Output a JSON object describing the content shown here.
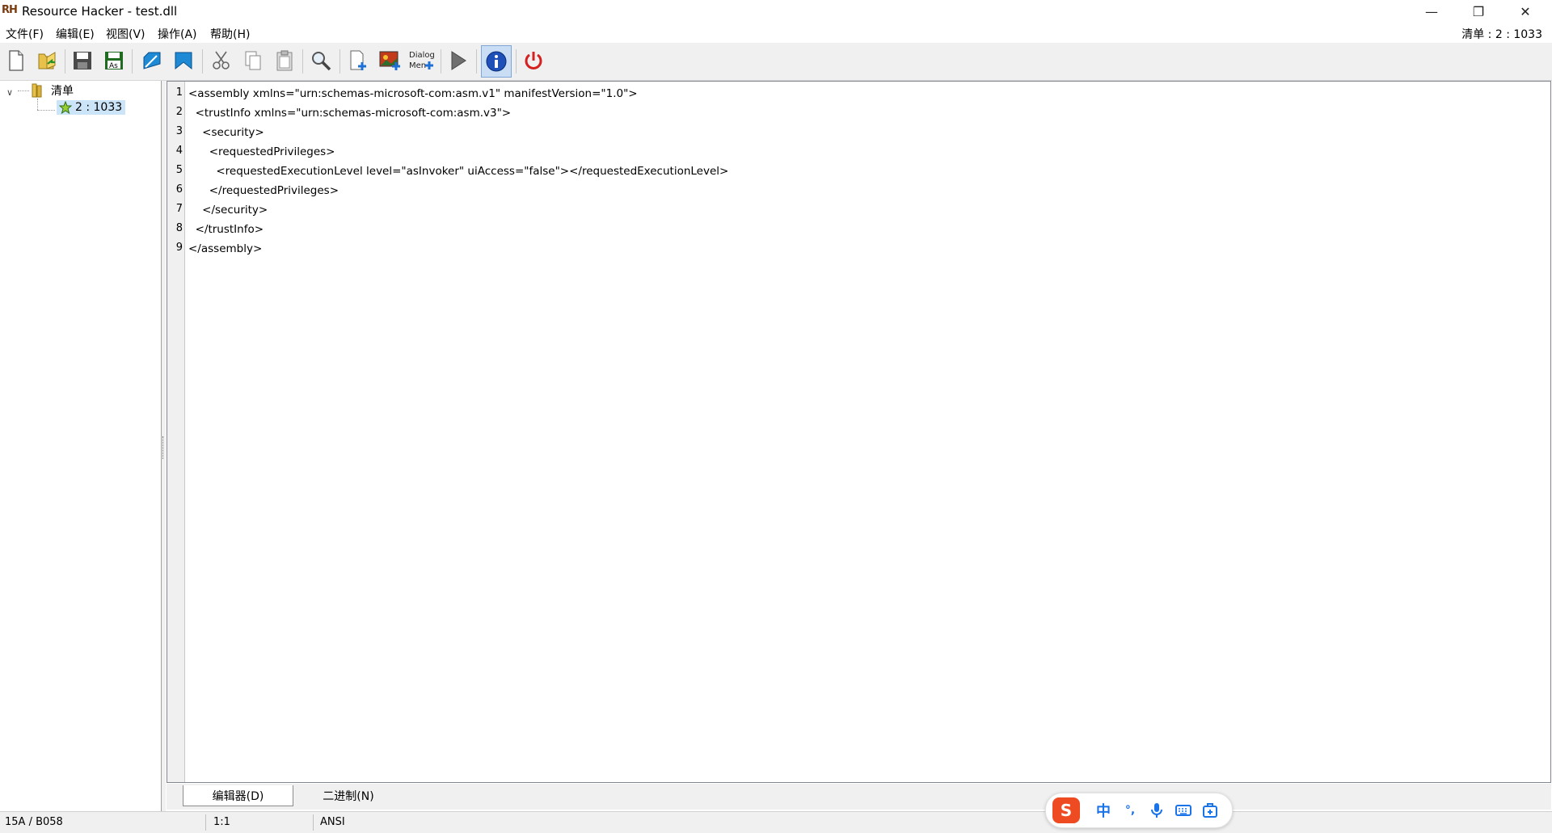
{
  "window": {
    "title": "Resource Hacker - test.dll",
    "icon_text": "RH"
  },
  "window_controls": {
    "minimize": "—",
    "restore": "❐",
    "close": "✕"
  },
  "menu": {
    "items": [
      {
        "label": "文件(F)"
      },
      {
        "label": "编辑(E)"
      },
      {
        "label": "视图(V)"
      },
      {
        "label": "操作(A)"
      },
      {
        "label": "帮助(H)"
      }
    ],
    "status": "清单 : 2 : 1033"
  },
  "toolbar": {
    "buttons": [
      {
        "icon": "new-file-icon"
      },
      {
        "icon": "open-folder-icon"
      },
      {
        "icon": "save-icon"
      },
      {
        "icon": "save-as-icon",
        "text": "As"
      },
      {
        "icon": "compile-script-icon"
      },
      {
        "icon": "back-icon"
      },
      {
        "icon": "cut-icon"
      },
      {
        "icon": "copy-icon"
      },
      {
        "icon": "paste-icon"
      },
      {
        "icon": "search-icon"
      },
      {
        "icon": "add-resource-icon"
      },
      {
        "icon": "add-image-icon"
      },
      {
        "icon": "dialog-menu-icon",
        "text_line1": "Dialog",
        "text_line2": "Men"
      },
      {
        "icon": "play-icon"
      },
      {
        "icon": "info-icon"
      },
      {
        "icon": "power-icon"
      }
    ],
    "colors": {
      "blue": "#1e6fd6",
      "red": "#d42020",
      "green": "#2a8f2a",
      "gray": "#6b6b6b"
    }
  },
  "tree": {
    "root": {
      "label": "清单",
      "expanded": true
    },
    "children": [
      {
        "label": "2 : 1033",
        "selected": true
      }
    ]
  },
  "editor": {
    "lines": [
      "<assembly xmlns=\"urn:schemas-microsoft-com:asm.v1\" manifestVersion=\"1.0\">",
      "  <trustInfo xmlns=\"urn:schemas-microsoft-com:asm.v3\">",
      "    <security>",
      "      <requestedPrivileges>",
      "        <requestedExecutionLevel level=\"asInvoker\" uiAccess=\"false\"></requestedExecutionLevel>",
      "      </requestedPrivileges>",
      "    </security>",
      "  </trustInfo>",
      "</assembly>"
    ],
    "line_numbers": [
      "1",
      "2",
      "3",
      "4",
      "5",
      "6",
      "7",
      "8",
      "9"
    ]
  },
  "tabs": [
    {
      "label": "编辑器(D)",
      "active": true
    },
    {
      "label": "二进制(N)",
      "active": false
    }
  ],
  "status_bar": {
    "address": "15A / B058",
    "position": "1:1",
    "encoding": "ANSI"
  },
  "ime": {
    "logo": "S",
    "items": [
      "中",
      "°,",
      "mic-icon",
      "keyboard-icon",
      "toolbox-icon"
    ]
  }
}
